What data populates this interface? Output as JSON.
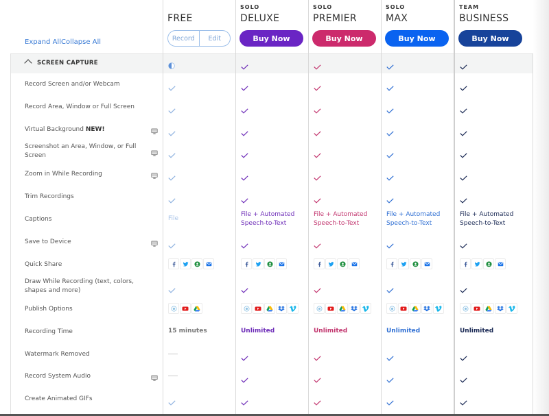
{
  "header": {
    "expand_all": "Expand All",
    "collapse_all": "Collapse All"
  },
  "plans": [
    {
      "key": "free",
      "tier": "",
      "name": "FREE",
      "buttons": [
        "Record",
        "Edit"
      ],
      "color": "#7aa3da"
    },
    {
      "key": "deluxe",
      "tier": "SOLO",
      "name": "DELUXE",
      "button": "Buy Now",
      "color": "#6e2db8",
      "button_color": "#6a25c4"
    },
    {
      "key": "premier",
      "tier": "SOLO",
      "name": "PREMIER",
      "button": "Buy Now",
      "color": "#c2356e",
      "button_color": "#cc2a6c"
    },
    {
      "key": "max",
      "tier": "SOLO",
      "name": "MAX",
      "button": "Buy Now",
      "color": "#2f6fd3",
      "button_color": "#0a63f0"
    },
    {
      "key": "business",
      "tier": "TEAM",
      "name": "BUSINESS",
      "button": "Buy Now",
      "color": "#1b2a55",
      "button_color": "#17439a"
    }
  ],
  "section": {
    "label": "SCREEN CAPTURE",
    "values": [
      "half",
      "check",
      "check",
      "check",
      "check"
    ]
  },
  "features": [
    {
      "label": "Record Screen and/or Webcam",
      "desktop_only": false,
      "values": [
        "check",
        "check",
        "check",
        "check",
        "check"
      ]
    },
    {
      "label": "Record Area, Window or Full Screen",
      "desktop_only": false,
      "values": [
        "check",
        "check",
        "check",
        "check",
        "check"
      ]
    },
    {
      "label": "Virtual Background",
      "badge": "NEW!",
      "desktop_only": true,
      "values": [
        "check",
        "check",
        "check",
        "check",
        "check"
      ]
    },
    {
      "label": "Screenshot an Area, Window, or Full Screen",
      "desktop_only": true,
      "values": [
        "check",
        "check",
        "check",
        "check",
        "check"
      ]
    },
    {
      "label": "Zoom in While Recording",
      "desktop_only": true,
      "values": [
        "check",
        "check",
        "check",
        "check",
        "check"
      ]
    },
    {
      "label": "Trim Recordings",
      "desktop_only": false,
      "values": [
        "check",
        "check",
        "check",
        "check",
        "check"
      ]
    },
    {
      "label": "Captions",
      "desktop_only": false,
      "values": [
        "File",
        "File + Automated Speech-to-Text",
        "File + Automated Speech-to-Text",
        "File + Automated Speech-to-Text",
        "File + Automated Speech-to-Text"
      ]
    },
    {
      "label": "Save to Device",
      "desktop_only": true,
      "values": [
        "check",
        "check",
        "check",
        "check",
        "check"
      ]
    },
    {
      "label": "Quick Share",
      "desktop_only": false,
      "values": [
        [
          "facebook",
          "twitter",
          "google-classroom",
          "email"
        ],
        [
          "facebook",
          "twitter",
          "google-classroom",
          "email"
        ],
        [
          "facebook",
          "twitter",
          "google-classroom",
          "email"
        ],
        [
          "facebook",
          "twitter",
          "google-classroom",
          "email"
        ],
        [
          "facebook",
          "twitter",
          "google-classroom",
          "email"
        ]
      ]
    },
    {
      "label": "Draw While Recording (text, colors, shapes and more)",
      "desktop_only": false,
      "values": [
        "check",
        "check",
        "check",
        "check",
        "check"
      ]
    },
    {
      "label": "Publish Options",
      "desktop_only": false,
      "values": [
        [
          "screencast",
          "youtube",
          "google-drive"
        ],
        [
          "screencast",
          "youtube",
          "google-drive",
          "dropbox",
          "vimeo"
        ],
        [
          "screencast",
          "youtube",
          "google-drive",
          "dropbox",
          "vimeo"
        ],
        [
          "screencast",
          "youtube",
          "google-drive",
          "dropbox",
          "vimeo"
        ],
        [
          "screencast",
          "youtube",
          "google-drive",
          "dropbox",
          "vimeo"
        ]
      ]
    },
    {
      "label": "Recording Time",
      "desktop_only": false,
      "values": [
        "15 minutes",
        "Unlimited",
        "Unlimited",
        "Unlimited",
        "Unlimited"
      ]
    },
    {
      "label": "Watermark Removed",
      "desktop_only": false,
      "values": [
        "dash",
        "check",
        "check",
        "check",
        "check"
      ]
    },
    {
      "label": "Record System Audio",
      "desktop_only": true,
      "values": [
        "dash",
        "check",
        "check",
        "check",
        "check"
      ]
    },
    {
      "label": "Create Animated GIFs",
      "desktop_only": false,
      "values": [
        "check",
        "check",
        "check",
        "check",
        "check"
      ]
    }
  ]
}
